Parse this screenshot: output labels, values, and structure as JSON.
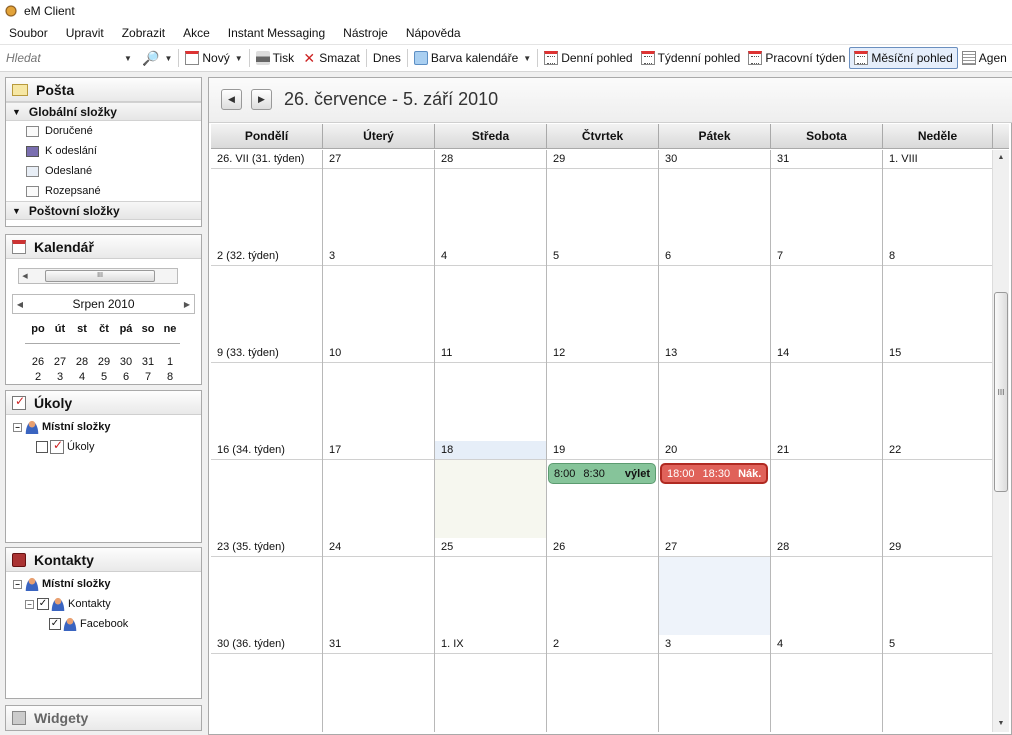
{
  "window": {
    "title": "eM Client"
  },
  "menu": [
    "Soubor",
    "Upravit",
    "Zobrazit",
    "Akce",
    "Instant Messaging",
    "Nástroje",
    "Nápověda"
  ],
  "toolbar": {
    "search_placeholder": "Hledat",
    "new_label": "Nový",
    "print_label": "Tisk",
    "delete_label": "Smazat",
    "today_label": "Dnes",
    "color_label": "Barva kalendáře",
    "day_view": "Denní pohled",
    "week_view": "Týdenní pohled",
    "workweek_view": "Pracovní týden",
    "month_view": "Měsíční pohled",
    "agenda_view": "Agen"
  },
  "mail": {
    "title": "Pošta",
    "global_folders": "Globální složky",
    "folders": [
      "Doručené",
      "K odeslání",
      "Odeslané",
      "Rozepsané"
    ],
    "mail_folders": "Poštovní složky"
  },
  "calendar_panel": {
    "title": "Kalendář",
    "scroll_grip": "III",
    "mini_month": "Srpen 2010",
    "dow": [
      "po",
      "út",
      "st",
      "čt",
      "pá",
      "so",
      "ne"
    ],
    "row1": [
      "26",
      "27",
      "28",
      "29",
      "30",
      "31",
      "1"
    ],
    "row2": [
      "2",
      "3",
      "4",
      "5",
      "6",
      "7",
      "8"
    ]
  },
  "tasks": {
    "title": "Úkoly",
    "local": "Místní složky",
    "item": "Úkoly"
  },
  "contacts": {
    "title": "Kontakty",
    "local": "Místní složky",
    "items": [
      "Kontakty",
      "Facebook"
    ]
  },
  "widgets": {
    "title": "Widgety"
  },
  "main": {
    "range": "26. července - 5. září 2010",
    "scroll_grip": "III",
    "days": [
      "Pondělí",
      "Úterý",
      "Středa",
      "Čtvrtek",
      "Pátek",
      "Sobota",
      "Neděle"
    ],
    "weeks": [
      [
        "26. VII  (31. týden)",
        "27",
        "28",
        "29",
        "30",
        "31",
        "1. VIII"
      ],
      [
        "2   (32. týden)",
        "3",
        "4",
        "5",
        "6",
        "7",
        "8"
      ],
      [
        "9   (33. týden)",
        "10",
        "11",
        "12",
        "13",
        "14",
        "15"
      ],
      [
        "16   (34. týden)",
        "17",
        "18",
        "19",
        "20",
        "21",
        "22"
      ],
      [
        "23   (35. týden)",
        "24",
        "25",
        "26",
        "27",
        "28",
        "29"
      ],
      [
        "30   (36. týden)",
        "31",
        "1. IX",
        "2",
        "3",
        "4",
        "5"
      ]
    ],
    "events": [
      {
        "start": "8:00",
        "end": "8:30",
        "title": "výlet",
        "color": "#86c49a"
      },
      {
        "start": "18:00",
        "end": "18:30",
        "title": "Nák...",
        "color": "#e0625a"
      }
    ]
  }
}
